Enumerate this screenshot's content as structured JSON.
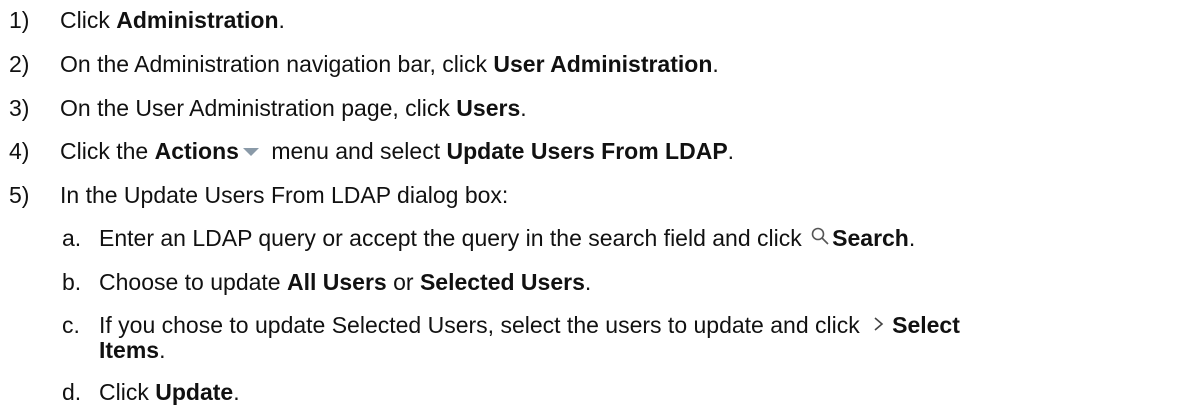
{
  "steps": [
    {
      "num": "1)",
      "parts": [
        "Click ",
        "Administration",
        "."
      ]
    },
    {
      "num": "2)",
      "parts": [
        "On the Administration navigation bar, click ",
        "User Administration",
        "."
      ]
    },
    {
      "num": "3)",
      "parts": [
        "On the User Administration page, click ",
        "Users",
        "."
      ]
    },
    {
      "num": "4)",
      "parts": [
        "Click the ",
        "Actions",
        " menu and select ",
        "Update Users From LDAP",
        "."
      ]
    },
    {
      "num": "5)",
      "parts": [
        "In the Update Users From LDAP dialog box:"
      ]
    }
  ],
  "substeps": [
    {
      "num": "a.",
      "parts": [
        "Enter an LDAP query or accept the query in the search field and click ",
        "Search",
        "."
      ]
    },
    {
      "num": "b.",
      "parts": [
        "Choose to update ",
        "All Users",
        " or ",
        "Selected Users",
        "."
      ]
    },
    {
      "num": "c.",
      "parts": [
        "If you chose to update Selected Users, select the users to update and click ",
        "Select",
        "Items",
        "."
      ]
    },
    {
      "num": "d.",
      "parts": [
        "Click ",
        "Update",
        "."
      ]
    }
  ],
  "icons": {
    "actions_menu": "chevron-down-icon",
    "search": "search-icon",
    "select_items": "chevron-right-icon"
  }
}
